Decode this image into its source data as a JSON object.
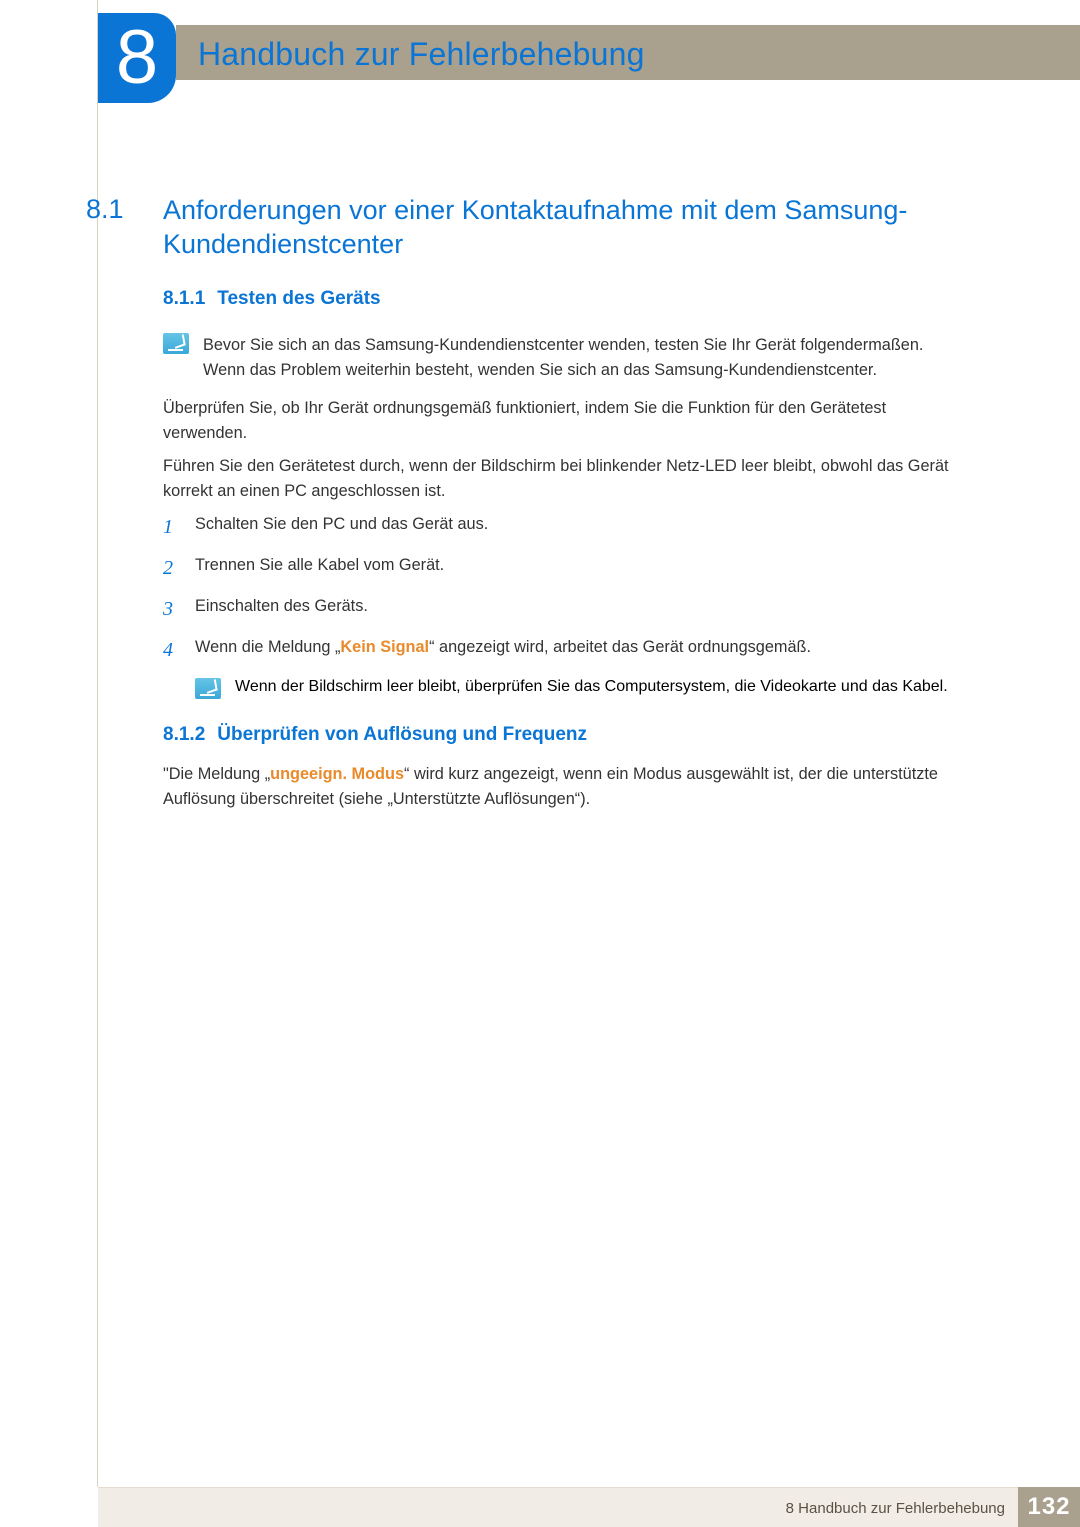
{
  "chapter": {
    "number": "8",
    "title": "Handbuch zur Fehlerbehebung"
  },
  "section": {
    "number": "8.1",
    "title": "Anforderungen vor einer Kontaktaufnahme mit dem Samsung-Kundendienstcenter"
  },
  "subsection1": {
    "number": "8.1.1",
    "title": "Testen des Geräts",
    "note": "Bevor Sie sich an das Samsung-Kundendienstcenter wenden, testen Sie Ihr Gerät folgendermaßen. Wenn das Problem weiterhin besteht, wenden Sie sich an das Samsung-Kundendienstcenter.",
    "para1": "Überprüfen Sie, ob Ihr Gerät ordnungsgemäß funktioniert, indem Sie die Funktion für den Gerätetest verwenden.",
    "para2": "Führen Sie den Gerätetest durch, wenn der Bildschirm bei blinkender Netz-LED leer bleibt, obwohl das Gerät korrekt an einen PC angeschlossen ist.",
    "steps": [
      {
        "n": "1",
        "text": "Schalten Sie den PC und das Gerät aus."
      },
      {
        "n": "2",
        "text": "Trennen Sie alle Kabel vom Gerät."
      },
      {
        "n": "3",
        "text": "Einschalten des Geräts."
      },
      {
        "n": "4",
        "pre": "Wenn die Meldung „",
        "bold": "Kein Signal",
        "post": "“ angezeigt wird, arbeitet das Gerät ordnungsgemäß."
      }
    ],
    "nested_note": "Wenn der Bildschirm leer bleibt, überprüfen Sie das Computersystem, die Videokarte und das Kabel."
  },
  "subsection2": {
    "number": "8.1.2",
    "title": "Überprüfen von Auflösung und Frequenz",
    "para_pre": "\"Die Meldung „",
    "para_bold": "ungeeign. Modus",
    "para_post": "“ wird kurz angezeigt, wenn ein Modus ausgewählt ist, der die unterstützte Auflösung überschreitet (siehe „Unterstützte Auflösungen“)."
  },
  "footer": {
    "chapter_label": "8 Handbuch zur Fehlerbehebung",
    "page": "132"
  }
}
